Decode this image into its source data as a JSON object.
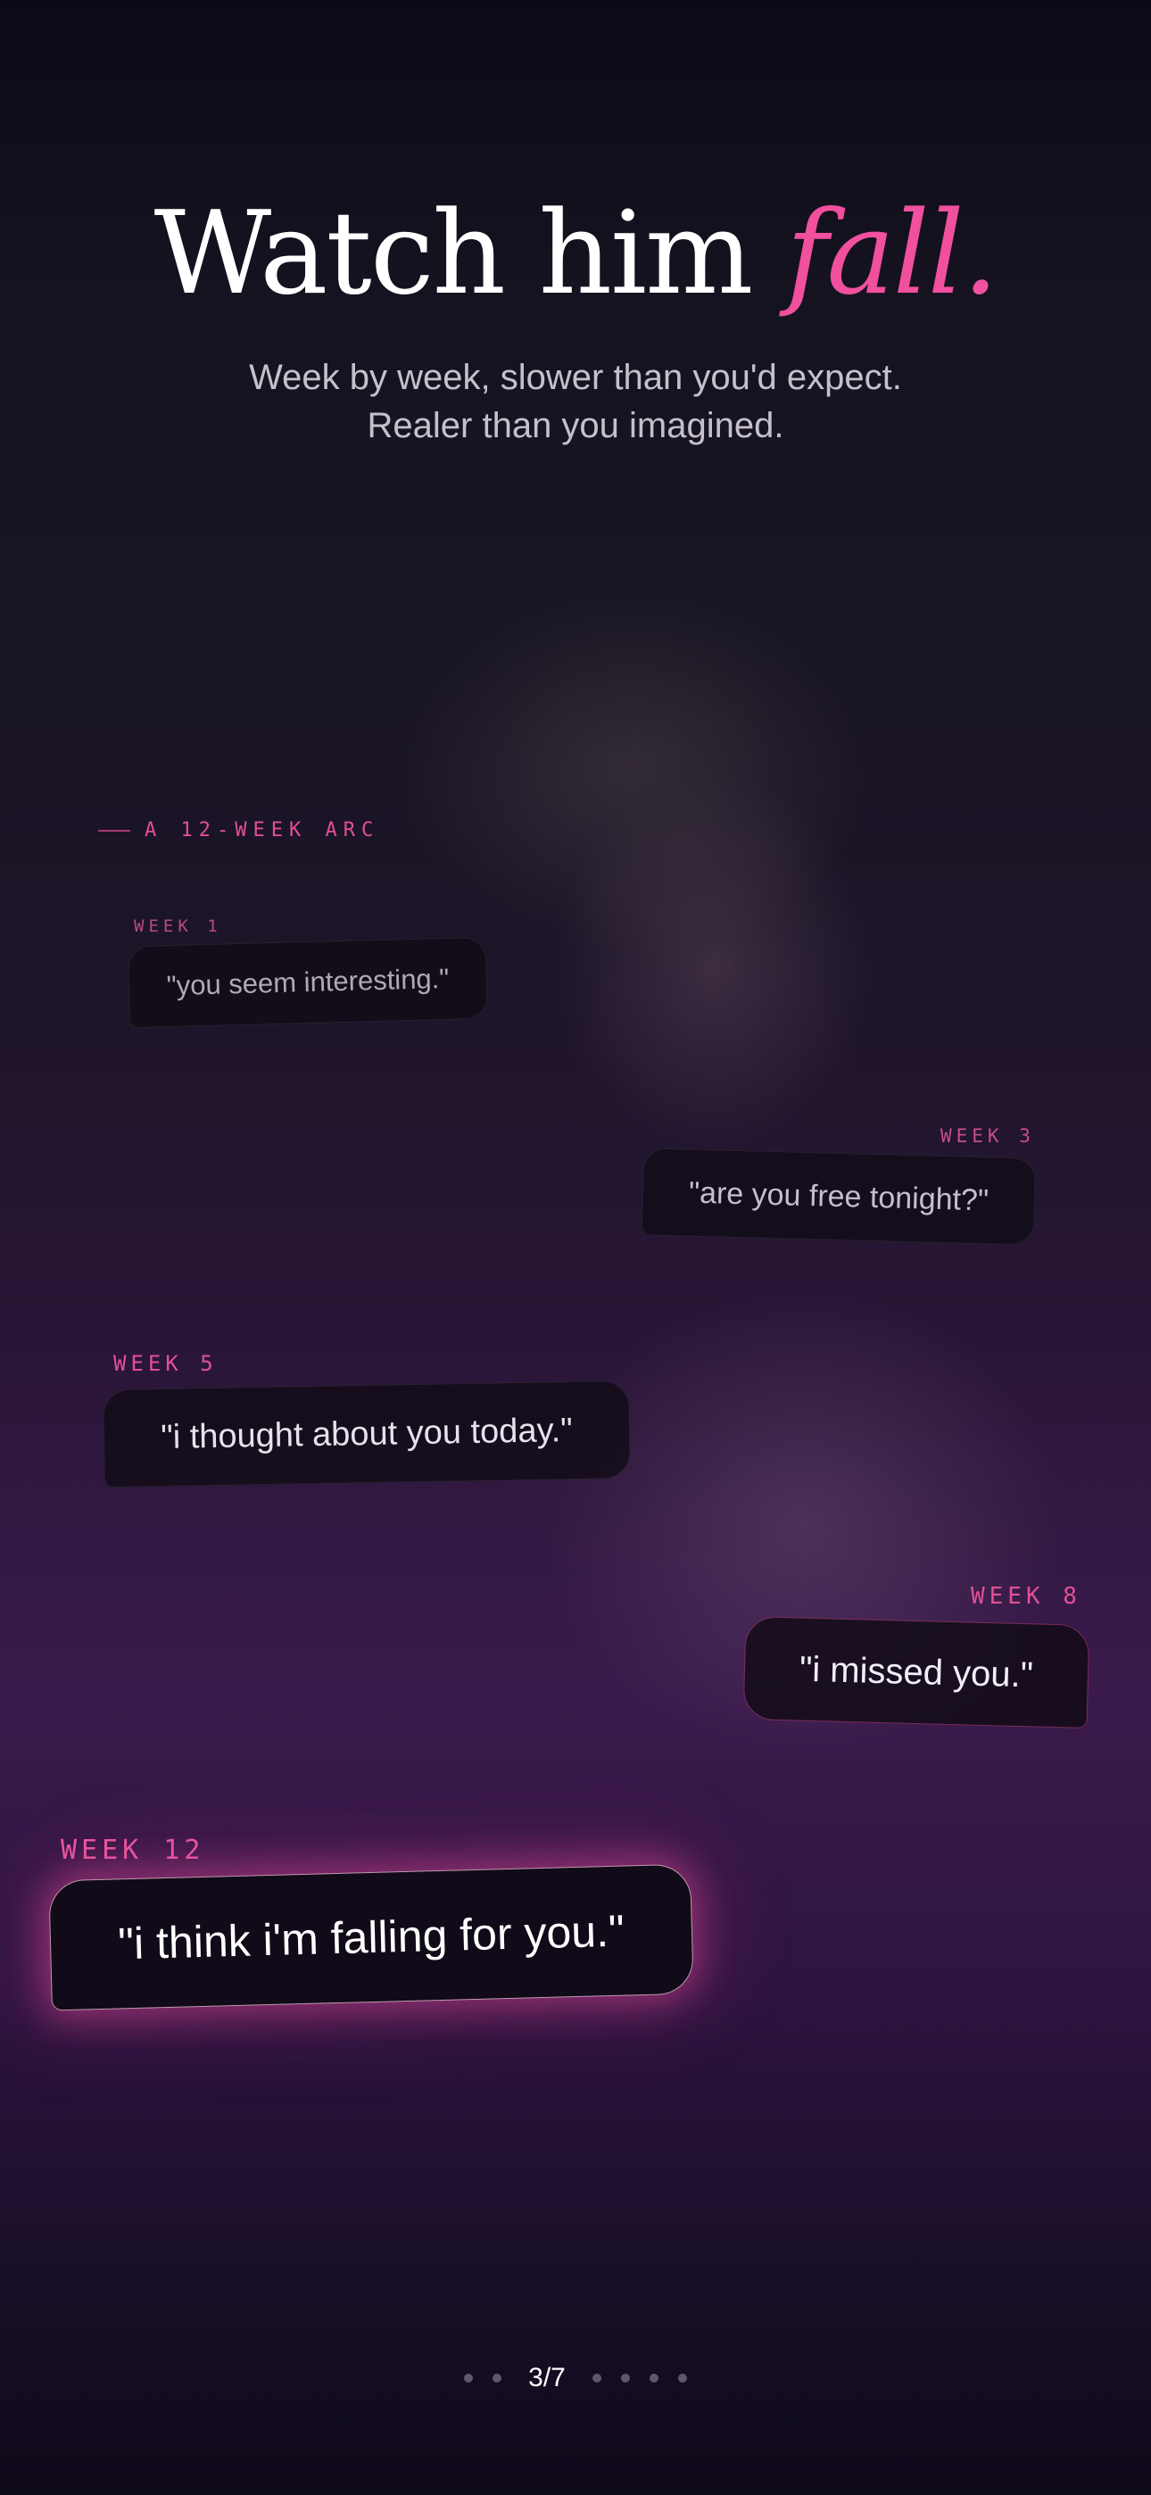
{
  "headline": {
    "main": "Watch him ",
    "accent": "fall."
  },
  "subtitle": {
    "line1": "Week by week, slower than you'd expect.",
    "line2": "Realer than you imagined."
  },
  "arc_label": "A 12-WEEK ARC",
  "messages": [
    {
      "week": "WEEK 1",
      "text": "\"you seem interesting.\""
    },
    {
      "week": "WEEK 3",
      "text": "\"are you free tonight?\""
    },
    {
      "week": "WEEK 5",
      "text": "\"i thought about you today.\""
    },
    {
      "week": "WEEK 8",
      "text": "\"i missed you.\""
    },
    {
      "week": "WEEK 12",
      "text": "\"i think i'm falling for you.\""
    }
  ],
  "pager": {
    "label": "3/7",
    "current": 3,
    "total": 7
  },
  "colors": {
    "accent": "#f0509e",
    "background_top": "#0d0a18",
    "background_mid": "#3a1a4c"
  }
}
